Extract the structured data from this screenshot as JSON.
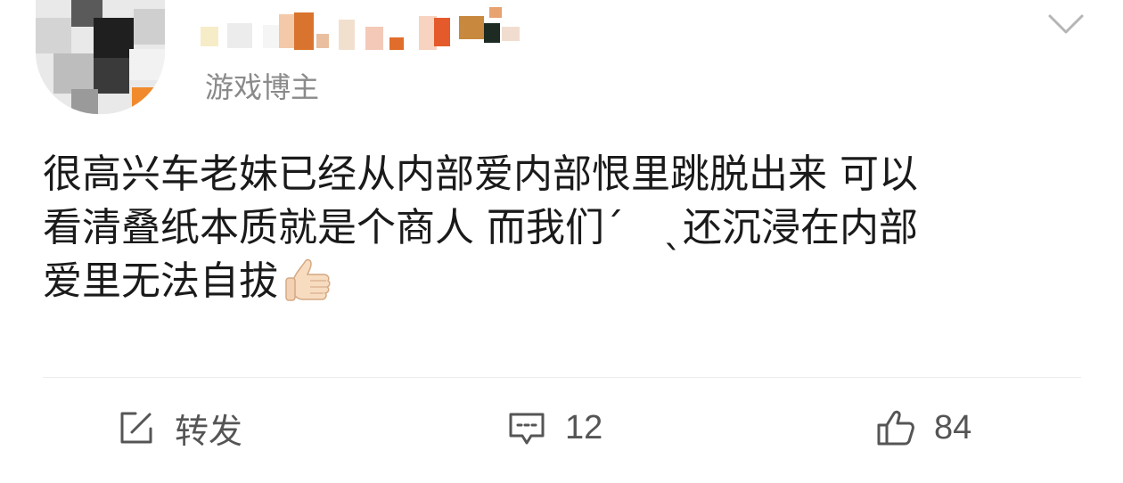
{
  "user": {
    "verified_label": "游戏博主"
  },
  "post": {
    "lines": [
      "很高兴车老妹已经从内部爱内部恨里跳脱出来 可以",
      "看清叠纸本质就是个商人 而我们ˊ　ˎ还沉浸在内部",
      "爱里无法自拔"
    ],
    "emoji": "thumbs-up-icon"
  },
  "actions": {
    "repost_label": "转发",
    "comment_count": "12",
    "like_count": "84"
  },
  "colors": {
    "text": "#1a1a1a",
    "secondary": "#8a8a8a",
    "icon": "#555555"
  }
}
